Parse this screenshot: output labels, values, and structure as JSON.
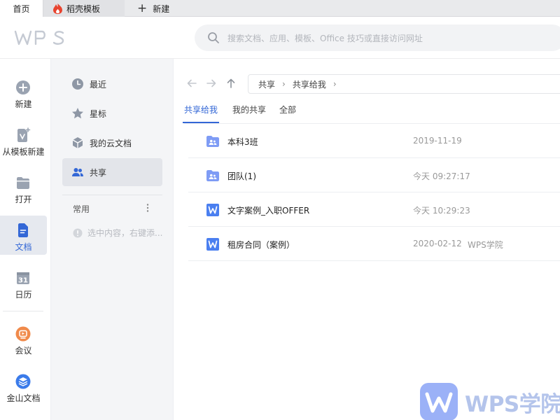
{
  "tabs": {
    "home": "首页",
    "template": "稻壳模板",
    "new": "新建"
  },
  "header": {
    "logo_icon": "wps-logo",
    "search_placeholder": "搜索文档、应用、模板、Office 技巧或直接访问网址"
  },
  "left_nav": [
    {
      "label": "新建",
      "icon": "plus-circle-icon"
    },
    {
      "label": "从模板新建",
      "icon": "template-icon"
    },
    {
      "label": "打开",
      "icon": "folder-icon"
    },
    {
      "label": "文档",
      "icon": "document-icon",
      "active": true
    },
    {
      "label": "日历",
      "icon": "calendar-icon",
      "calendar_day": "31"
    },
    {
      "label": "会议",
      "icon": "meeting-icon"
    },
    {
      "label": "金山文档",
      "icon": "kdocs-icon"
    }
  ],
  "sidebar": {
    "items": [
      {
        "label": "最近",
        "icon": "clock-icon"
      },
      {
        "label": "星标",
        "icon": "star-icon"
      },
      {
        "label": "我的云文档",
        "icon": "cloud-cube-icon"
      },
      {
        "label": "共享",
        "icon": "people-icon",
        "active": true
      }
    ],
    "section_title": "常用",
    "hint": "选中内容，右键添..."
  },
  "main": {
    "breadcrumb": [
      "共享",
      "共享给我"
    ],
    "subtabs": [
      {
        "label": "共享给我",
        "active": true
      },
      {
        "label": "我的共享"
      },
      {
        "label": "全部"
      }
    ],
    "files": [
      {
        "name": "本科3班",
        "type": "shared-folder",
        "time": "2019-11-19",
        "source": ""
      },
      {
        "name": "团队(1)",
        "type": "shared-folder",
        "time": "今天 09:27:17",
        "source": ""
      },
      {
        "name": "文字案例_入职OFFER",
        "type": "word-doc",
        "time": "今天 10:29:23",
        "source": ""
      },
      {
        "name": "租房合同（案例）",
        "type": "word-doc",
        "time": "2020-02-12",
        "source": "WPS学院"
      }
    ]
  },
  "watermark": {
    "text": "WPS学院"
  },
  "colors": {
    "accent": "#3367d6",
    "folder": "#7f9cf5",
    "word": "#4a7ff0"
  }
}
